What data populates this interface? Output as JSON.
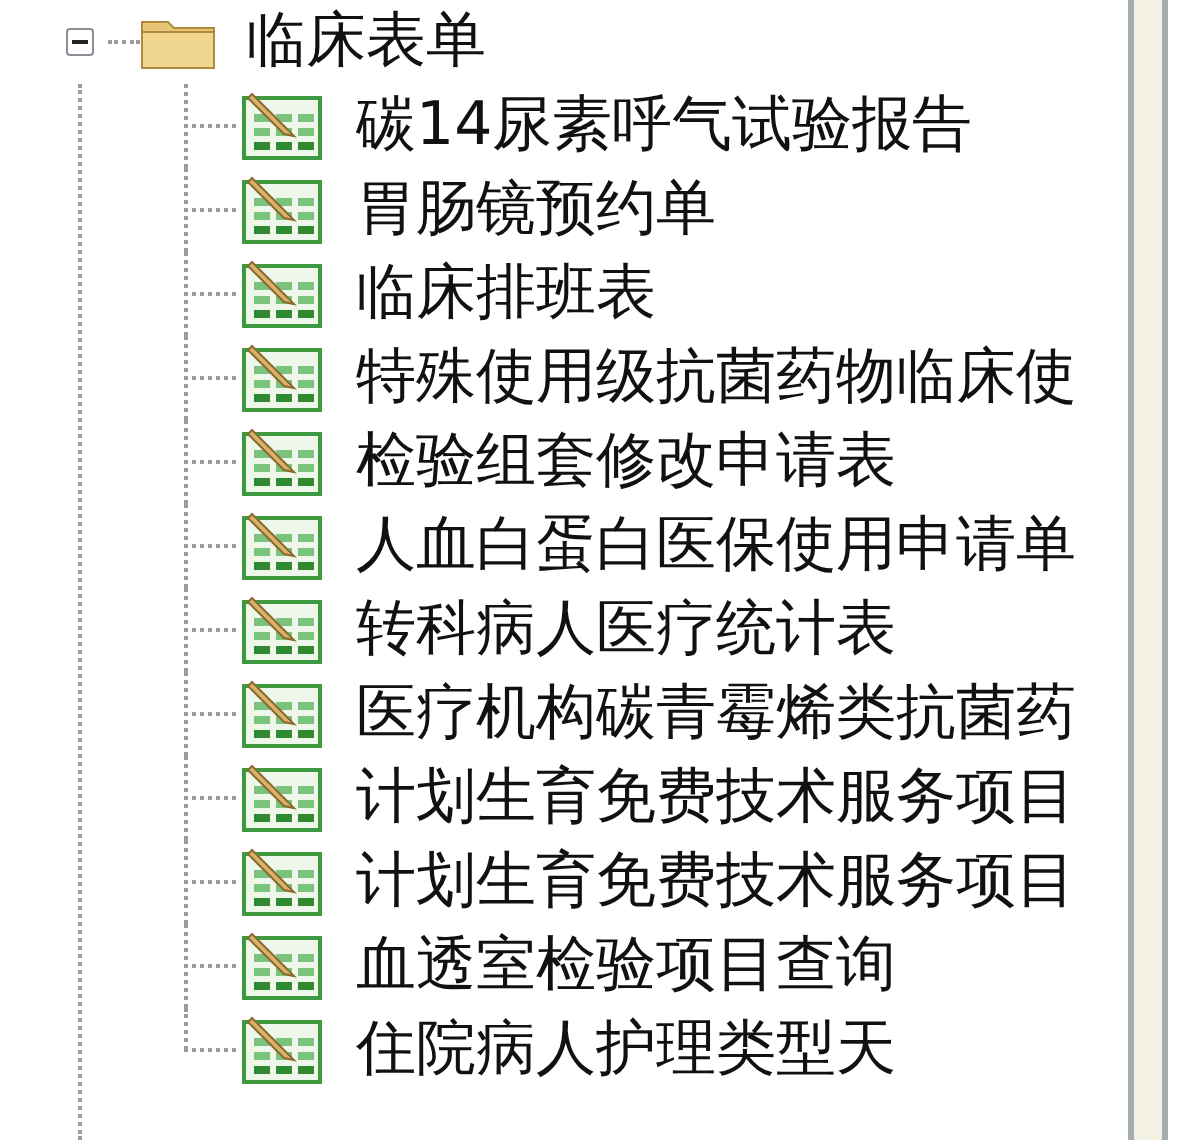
{
  "tree": {
    "root": {
      "label": "临床表单",
      "expanded": true,
      "children": [
        {
          "label": "碳14尿素呼气试验报告"
        },
        {
          "label": "胃肠镜预约单"
        },
        {
          "label": "临床排班表"
        },
        {
          "label": "特殊使用级抗菌药物临床使"
        },
        {
          "label": "检验组套修改申请表"
        },
        {
          "label": "人血白蛋白医保使用申请单"
        },
        {
          "label": "转科病人医疗统计表"
        },
        {
          "label": "医疗机构碳青霉烯类抗菌药"
        },
        {
          "label": "计划生育免费技术服务项目"
        },
        {
          "label": "计划生育免费技术服务项目"
        },
        {
          "label": "血透室检验项目查询"
        },
        {
          "label": "住院病人护理类型天"
        }
      ]
    }
  }
}
